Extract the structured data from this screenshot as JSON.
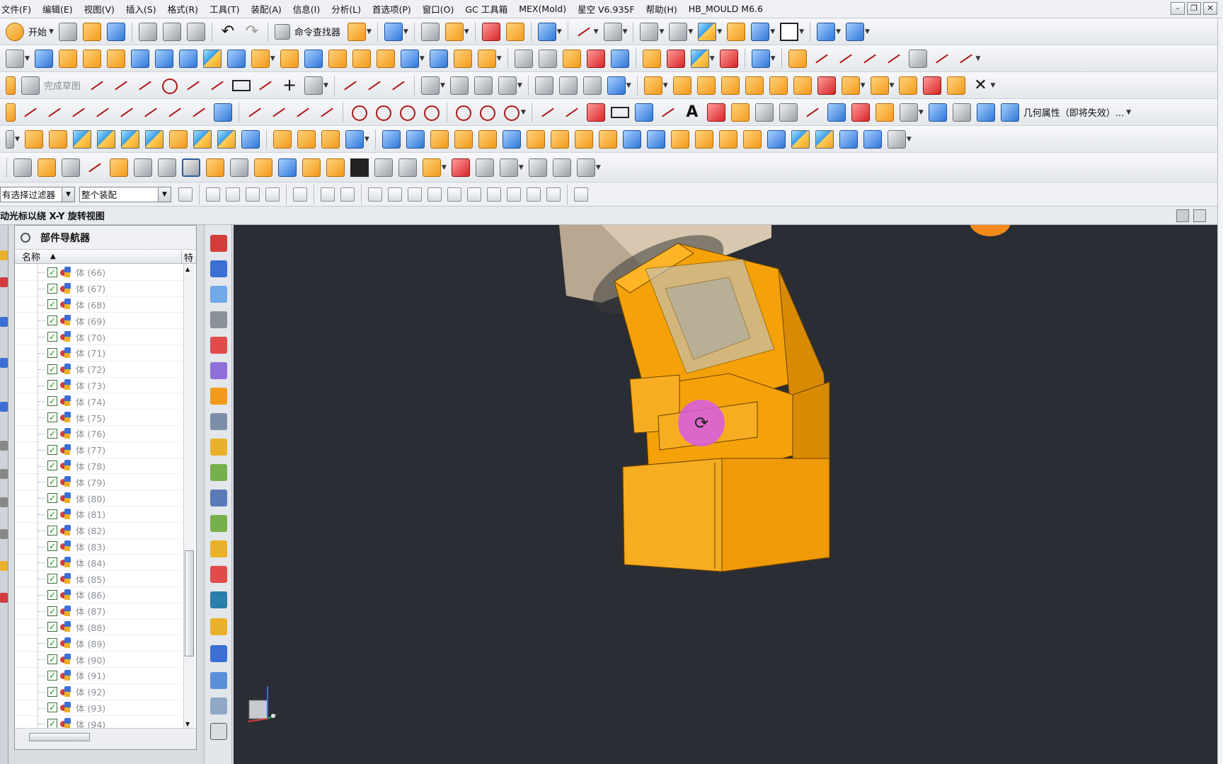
{
  "menu": [
    "文件(F)",
    "编辑(E)",
    "视图(V)",
    "插入(S)",
    "格式(R)",
    "工具(T)",
    "装配(A)",
    "信息(I)",
    "分析(L)",
    "首选项(P)",
    "窗口(O)",
    "GC 工具箱",
    "MEX(Mold)",
    "星空 V6.935F",
    "帮助(H)",
    "HB_MOULD M6.6"
  ],
  "toolbar": {
    "start_label": "开始",
    "command_finder_label": "命令查找器",
    "finish_sketch_label": "完成草图",
    "geometry_properties_label": "几何属性（即将失效）..."
  },
  "filter": {
    "type_filter": "有选择过滤器",
    "scope": "整个装配"
  },
  "status": {
    "prompt": "动光标以绕 X-Y 旋转视图"
  },
  "navigator": {
    "title": "部件导航器",
    "col_name": "名称",
    "col_feature": "特",
    "body_label": "体",
    "rows": [
      "(66)",
      "(67)",
      "(68)",
      "(69)",
      "(70)",
      "(71)",
      "(72)",
      "(73)",
      "(74)",
      "(75)",
      "(76)",
      "(77)",
      "(78)",
      "(79)",
      "(80)",
      "(81)",
      "(82)",
      "(83)",
      "(84)",
      "(85)",
      "(86)",
      "(87)",
      "(88)",
      "(89)",
      "(90)",
      "(91)",
      "(92)",
      "(93)",
      "(94)"
    ]
  },
  "colors": {
    "model_orange": "#f5a20a",
    "viewport_bg": "#2a2d33",
    "cursor_magenta": "#d65ce6"
  },
  "icons": {
    "rotate_cursor": "rotate-view-icon",
    "triad": "wcs-triad-icon"
  }
}
